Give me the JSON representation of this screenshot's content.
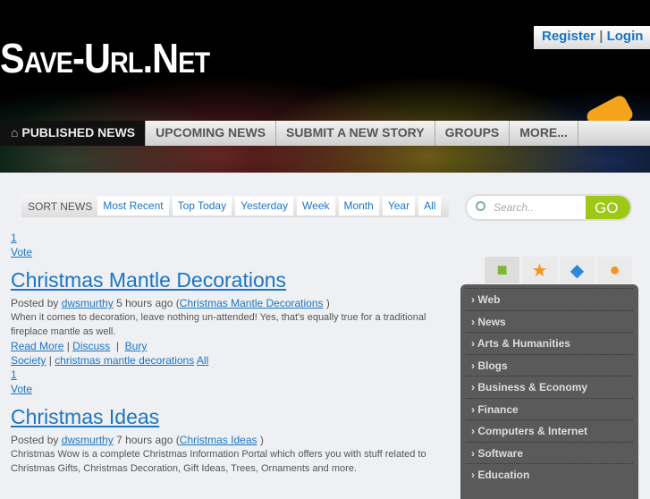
{
  "header": {
    "logo": "Save-Url.Net",
    "register": "Register",
    "separator": "|",
    "login": "Login"
  },
  "nav": [
    "PUBLISHED NEWS",
    "UPCOMING NEWS",
    "SUBMIT A NEW STORY",
    "GROUPS",
    "MORE..."
  ],
  "sort": {
    "label": "SORT NEWS",
    "options": [
      "Most Recent",
      "Top Today",
      "Yesterday",
      "Week",
      "Month",
      "Year",
      "All"
    ]
  },
  "search": {
    "placeholder": "Search..",
    "go": "GO"
  },
  "categories": [
    "Web",
    "News",
    "Arts & Humanities",
    "Blogs",
    "Business & Economy",
    "Finance",
    "Computers & Internet",
    "Software",
    "Education"
  ],
  "stories": [
    {
      "votes": "1",
      "vote_label": "Vote",
      "title": "Christmas Mantle Decorations",
      "posted_by": "Posted by",
      "author": "dwsmurthy",
      "time": "5 hours ago (",
      "source": "Christmas Mantle Decorations",
      "close": ")",
      "desc": "When it comes to decoration, leave nothing un-attended! Yes, that's equally true for a traditional fireplace mantle as well.",
      "read_more": "Read More",
      "discuss": "Discuss",
      "bury": "Bury",
      "category": "Society",
      "tag": "christmas mantle decorations",
      "all": "All"
    },
    {
      "votes": "1",
      "vote_label": "Vote",
      "title": "Christmas Ideas",
      "posted_by": "Posted by",
      "author": "dwsmurthy",
      "time": "7 hours ago (",
      "source": "Christmas Ideas",
      "close": ")",
      "desc": "Christmas Wow is a complete Christmas Information Portal which offers you with stuff related to Christmas Gifts, Christmas Decoration, Gift Ideas, Trees, Ornaments and more."
    }
  ]
}
